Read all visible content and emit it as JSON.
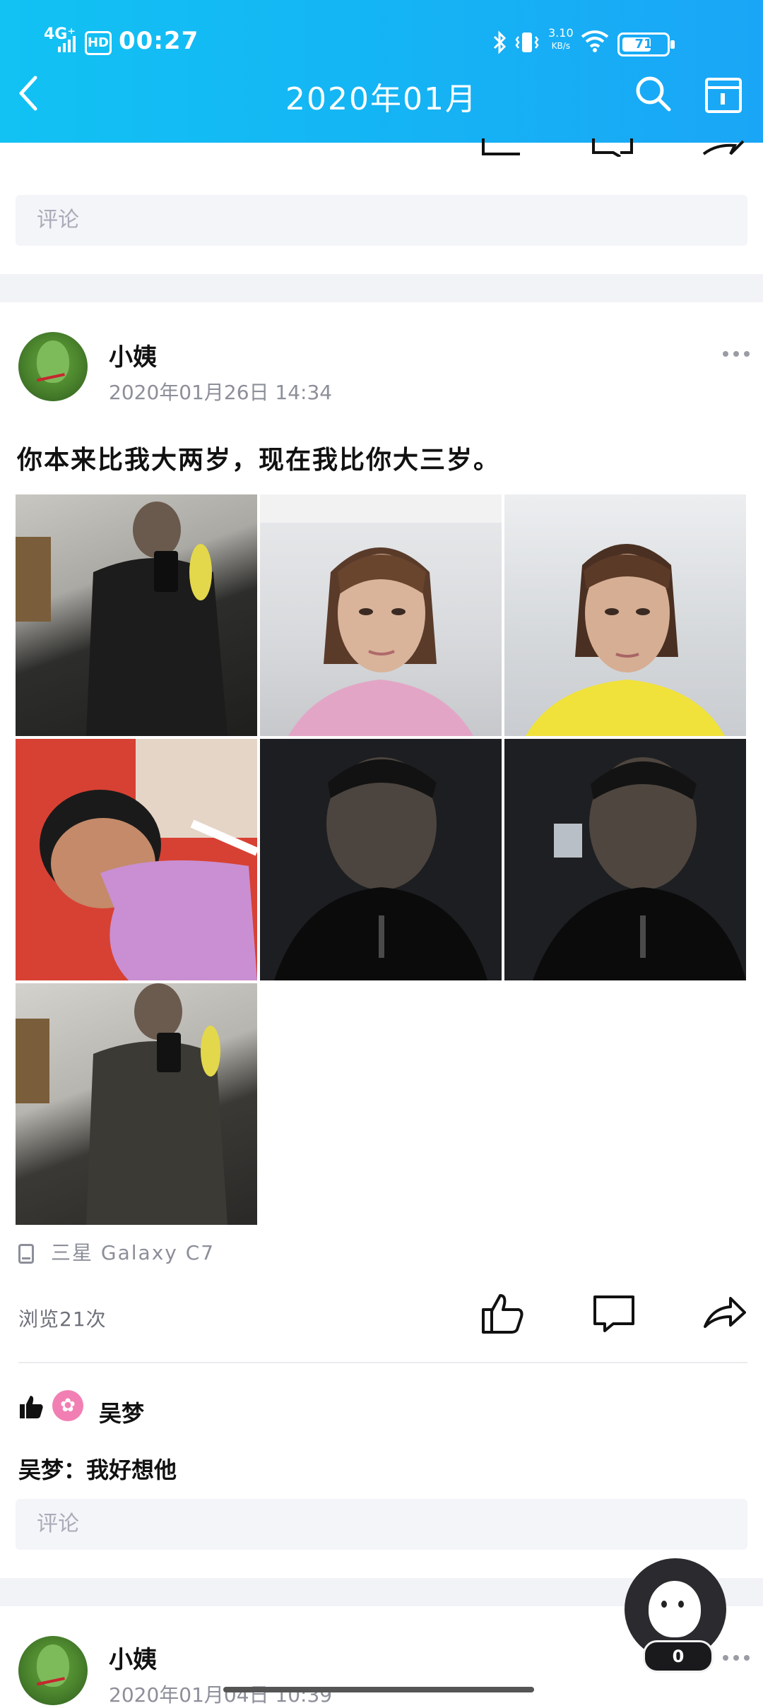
{
  "status_bar": {
    "network": "4G⁺",
    "hd": "HD",
    "time": "00:27",
    "speed_value": "3.10",
    "speed_unit": "KB/s",
    "battery": "71"
  },
  "header": {
    "title": "2020年01月",
    "back_icon": "back-arrow-icon",
    "search_icon": "search-icon",
    "calendar_icon": "calendar-icon"
  },
  "top_section": {
    "comment_placeholder": "评论"
  },
  "post": {
    "author": "小姨",
    "datetime": "2020年01月26日  14:34",
    "text": "你本来比我大两岁，现在我比你大三岁。",
    "photos": [
      {
        "desc": "man mirror selfie"
      },
      {
        "desc": "woman pink shirt"
      },
      {
        "desc": "woman yellow shirt"
      },
      {
        "desc": "man sleeping pink pillow"
      },
      {
        "desc": "man dark jacket"
      },
      {
        "desc": "man dark jacket window"
      },
      {
        "desc": "man mirror selfie 2"
      }
    ],
    "device": "三星 Galaxy C7",
    "views": "浏览21次",
    "likes": {
      "liker": "吴梦"
    },
    "comments": [
      {
        "author": "吴梦",
        "separator": "：",
        "text": "我好想他"
      }
    ],
    "comment_placeholder": "评论"
  },
  "next_post": {
    "author": "小姨",
    "datetime_partial": "2020年01月04日  10:39"
  },
  "floating_button": {
    "count": "0"
  }
}
